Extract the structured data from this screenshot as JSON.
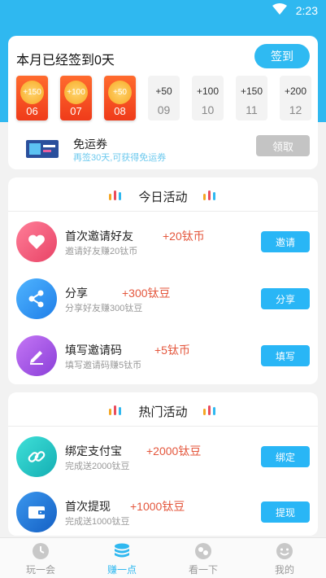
{
  "status_bar": {
    "time": "2:23"
  },
  "checkin": {
    "title": "本月已经签到0天",
    "button_label": "签到",
    "days": [
      {
        "reward": "+150",
        "day": "06",
        "checked": true
      },
      {
        "reward": "+100",
        "day": "07",
        "checked": true
      },
      {
        "reward": "+50",
        "day": "08",
        "checked": true
      },
      {
        "reward": "+50",
        "day": "09",
        "checked": false
      },
      {
        "reward": "+100",
        "day": "10",
        "checked": false
      },
      {
        "reward": "+150",
        "day": "11",
        "checked": false
      },
      {
        "reward": "+200",
        "day": "12",
        "checked": false
      }
    ],
    "coupon": {
      "title": "免运券",
      "subtitle": "再签30天,可获得免运券",
      "button_label": "领取"
    }
  },
  "today": {
    "title": "今日活动",
    "items": [
      {
        "title": "首次邀请好友",
        "reward": "+20钛币",
        "subtitle": "邀请好友赚20钛币",
        "button": "邀请",
        "icon": "heart-icon",
        "color": "#f0577d"
      },
      {
        "title": "分享",
        "reward": "+300钛豆",
        "subtitle": "分享好友赚300钛豆",
        "button": "分享",
        "icon": "share-icon",
        "color": "#2a8ff0"
      },
      {
        "title": "填写邀请码",
        "reward": "+5钛币",
        "subtitle": "填写邀请码赚5钛币",
        "button": "填写",
        "icon": "pen-icon",
        "color": "#a452e0"
      }
    ]
  },
  "hot": {
    "title": "热门活动",
    "items": [
      {
        "title": "绑定支付宝",
        "reward": "+2000钛豆",
        "subtitle": "完成送2000钛豆",
        "button": "绑定",
        "icon": "link-icon",
        "color": "#22c4c4"
      },
      {
        "title": "首次提现",
        "reward": "+1000钛豆",
        "subtitle": "完成送1000钛豆",
        "button": "提现",
        "icon": "wallet-icon",
        "color": "#1e76d8"
      }
    ]
  },
  "tabs": [
    {
      "label": "玩一会",
      "icon": "clock-icon",
      "active": false
    },
    {
      "label": "赚一点",
      "icon": "coins-icon",
      "active": true
    },
    {
      "label": "看一下",
      "icon": "eye-icon",
      "active": false
    },
    {
      "label": "我的",
      "icon": "smile-icon",
      "active": false
    }
  ],
  "colors": {
    "accent": "#2fb8f0",
    "reward": "#e4573d",
    "checked_day": "#f04a20"
  }
}
